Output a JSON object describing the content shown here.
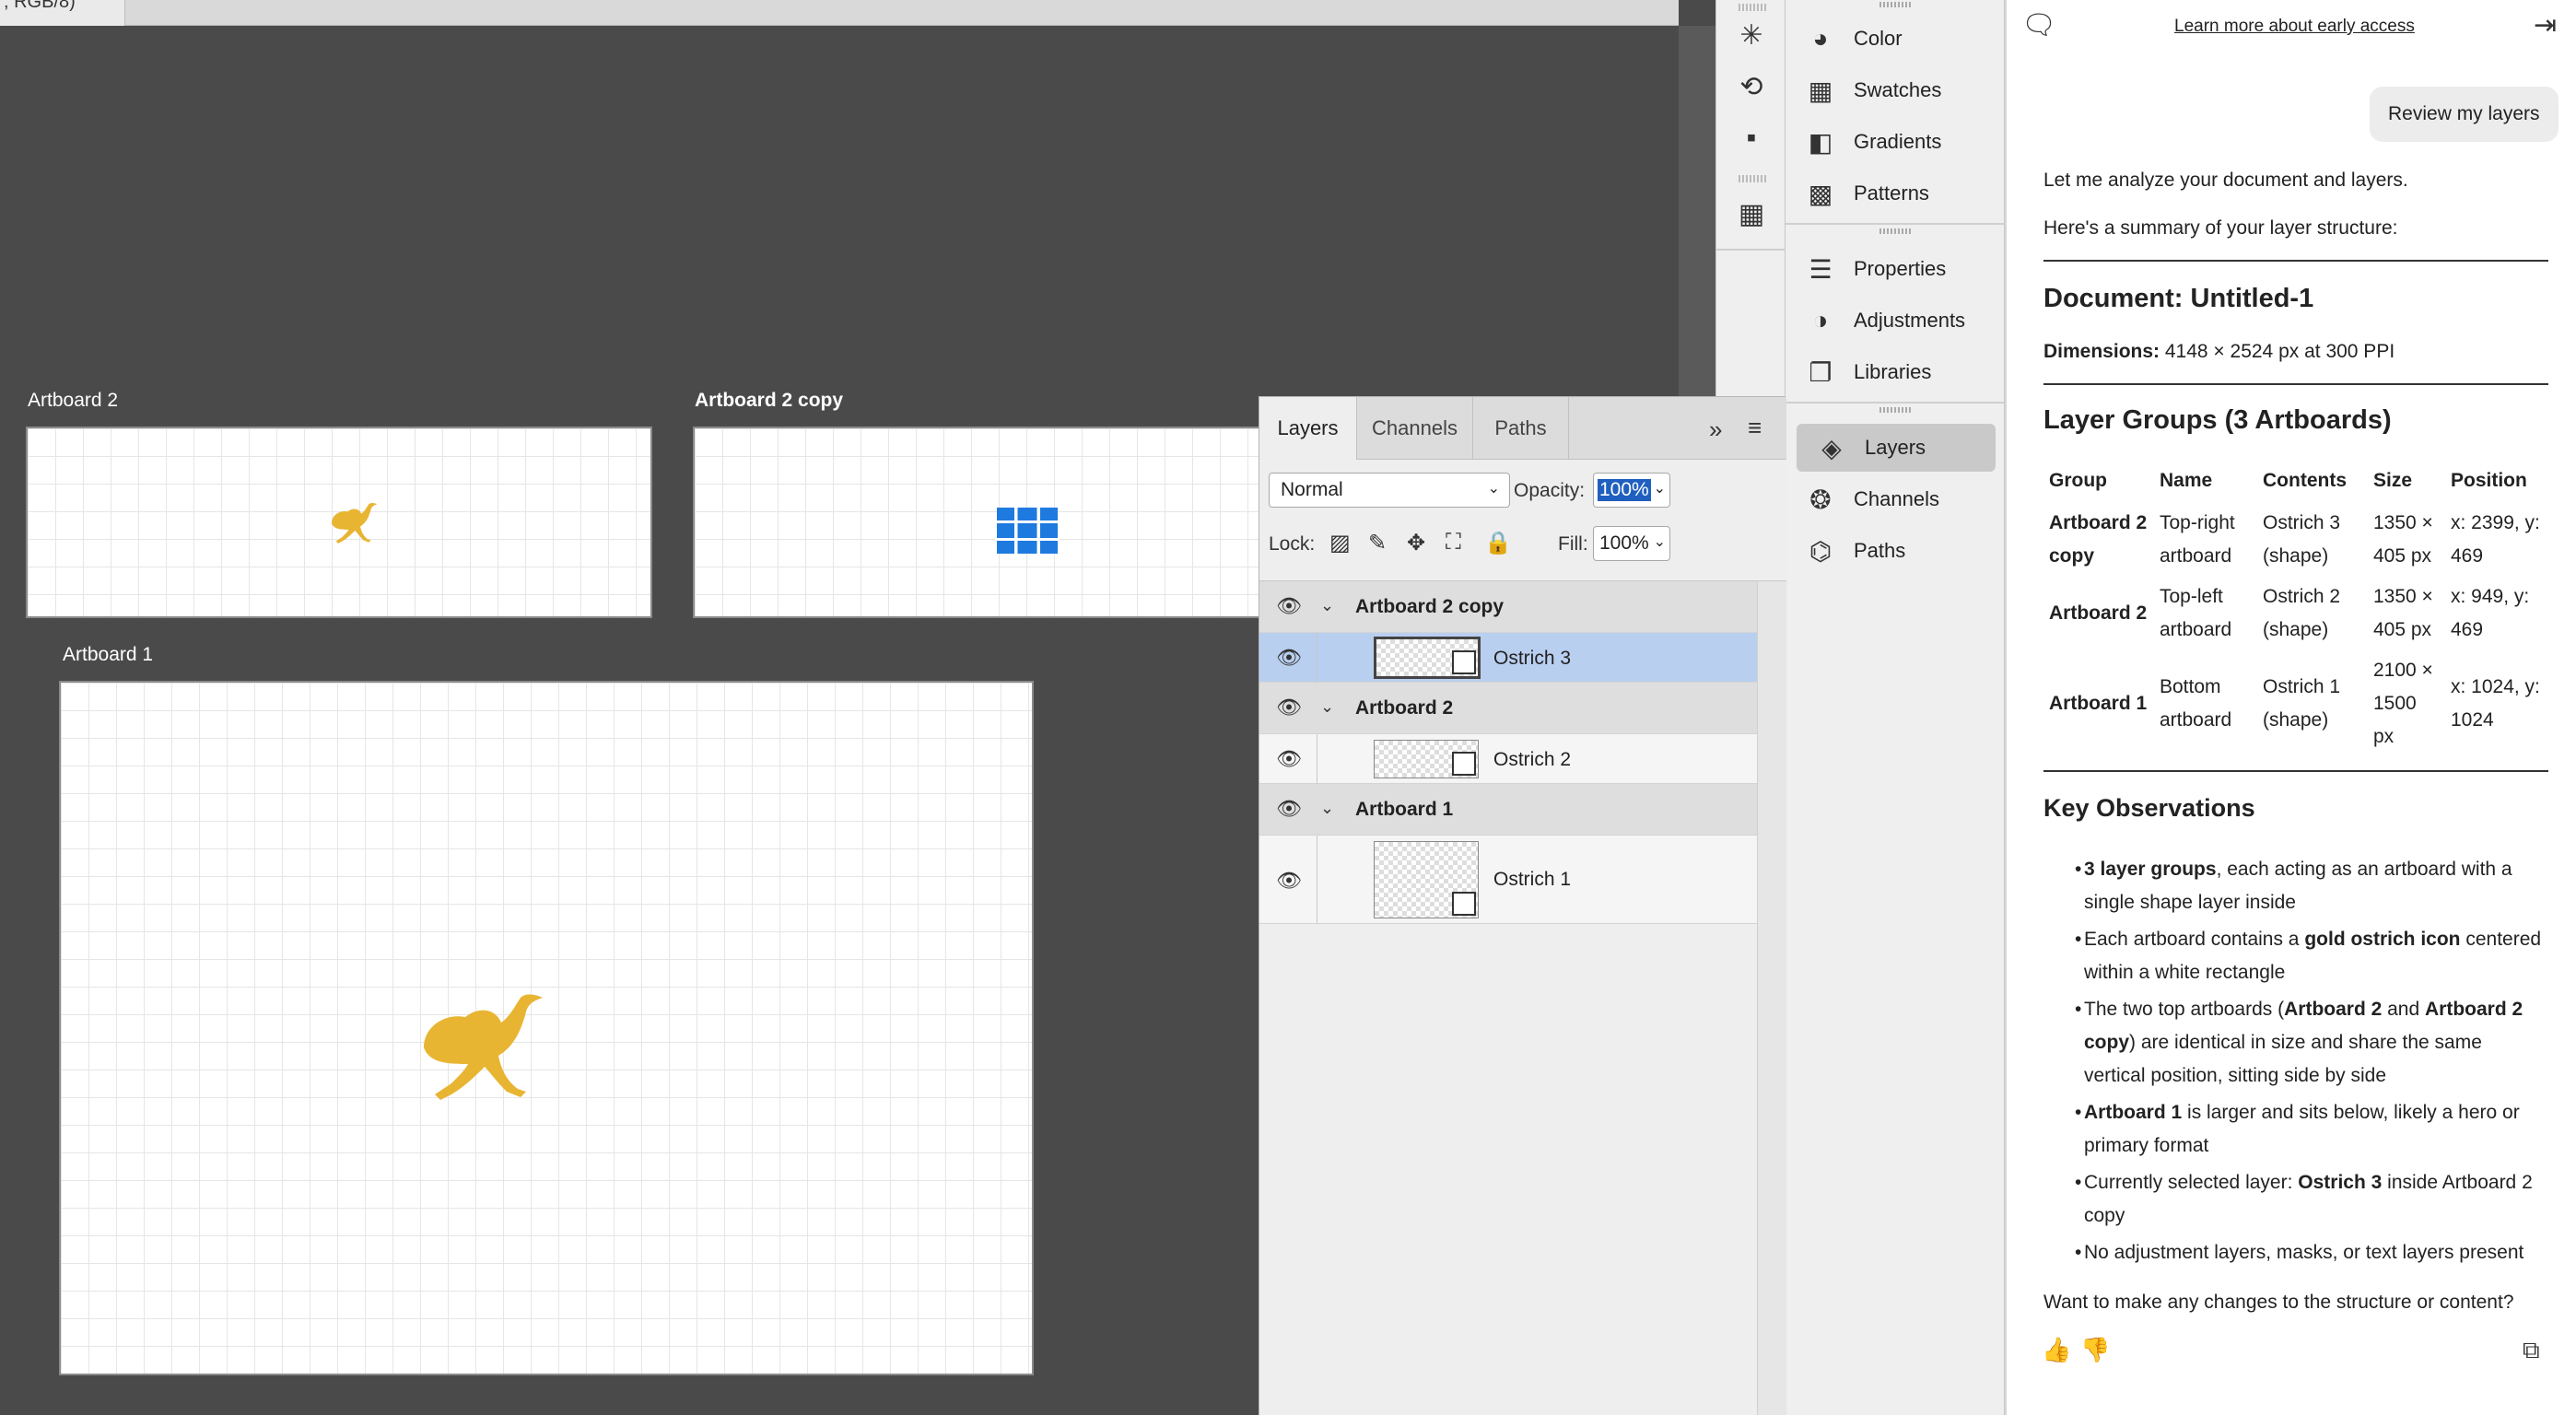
{
  "doc_tab": {
    "title": ", RGB/8)"
  },
  "canvas": {
    "artboards": [
      {
        "label": "Artboard 2"
      },
      {
        "label": "Artboard 2 copy"
      },
      {
        "label": "Artboard 1"
      }
    ]
  },
  "tools": [
    "magic-wand-icon",
    "history-brush-icon",
    "plugin-icon",
    "workspace-icon"
  ],
  "dock": {
    "items": [
      {
        "label": "Color",
        "icon": "palette-icon"
      },
      {
        "label": "Swatches",
        "icon": "swatches-icon"
      },
      {
        "label": "Gradients",
        "icon": "gradient-icon"
      },
      {
        "label": "Patterns",
        "icon": "patterns-icon"
      },
      {
        "label": "Properties",
        "icon": "properties-icon"
      },
      {
        "label": "Adjustments",
        "icon": "adjustments-icon"
      },
      {
        "label": "Libraries",
        "icon": "libraries-icon"
      },
      {
        "label": "Layers",
        "icon": "layers-icon"
      },
      {
        "label": "Channels",
        "icon": "channels-icon"
      },
      {
        "label": "Paths",
        "icon": "paths-icon"
      }
    ]
  },
  "layers_panel": {
    "tabs": [
      "Layers",
      "Channels",
      "Paths"
    ],
    "blend_mode": "Normal",
    "opacity_label": "Opacity:",
    "opacity_value": "100%",
    "lock_label": "Lock:",
    "fill_label": "Fill:",
    "fill_value": "100%",
    "groups": [
      {
        "name": "Artboard 2 copy",
        "layer": "Ostrich 3",
        "selected": true
      },
      {
        "name": "Artboard 2",
        "layer": "Ostrich 2",
        "selected": false
      },
      {
        "name": "Artboard 1",
        "layer": "Ostrich 1",
        "selected": false
      }
    ]
  },
  "assistant": {
    "early_access_link": "Learn more about early access",
    "user_message": "Review my layers",
    "intro": "Let me analyze your document and layers.",
    "summary_intro": "Here's a summary of your layer structure:",
    "doc_heading": "Document: Untitled-1",
    "dimensions_label": "Dimensions:",
    "dimensions_value": "4148 × 2524 px at 300 PPI",
    "groups_heading": "Layer Groups (3 Artboards)",
    "table": {
      "headers": [
        "Group",
        "Name",
        "Contents",
        "Size",
        "Position"
      ],
      "rows": [
        {
          "group": [
            "Artboard 2",
            "copy"
          ],
          "name": [
            "Top-right",
            "artboard"
          ],
          "contents": [
            "Ostrich 3",
            "(shape)"
          ],
          "size": [
            "1350 ×",
            "405 px"
          ],
          "position": [
            "x: 2399, y:",
            "469"
          ]
        },
        {
          "group": [
            "Artboard 2"
          ],
          "name": [
            "Top-left",
            "artboard"
          ],
          "contents": [
            "Ostrich 2",
            "(shape)"
          ],
          "size": [
            "1350 ×",
            "405 px"
          ],
          "position": [
            "x: 949, y:",
            "469"
          ]
        },
        {
          "group": [
            "Artboard 1"
          ],
          "name": [
            "Bottom",
            "artboard"
          ],
          "contents": [
            "Ostrich 1",
            "(shape)"
          ],
          "size": [
            "2100 ×",
            "1500",
            "px"
          ],
          "position": [
            "x: 1024, y:",
            "1024"
          ]
        }
      ]
    },
    "observations_heading": "Key Observations",
    "observations": [
      [
        "<b>3 layer groups</b>, each acting as an artboard with a",
        "single shape layer inside"
      ],
      [
        "Each artboard contains a <b>gold ostrich icon</b> centered",
        "within a white rectangle"
      ],
      [
        "The two top artboards (<b>Artboard 2</b> and <b>Artboard 2</b>",
        "<b>copy</b>) are identical in size and share the same",
        "vertical position, sitting side by side"
      ],
      [
        "<b>Artboard 1</b> is larger and sits below, likely a hero or",
        "primary format"
      ],
      [
        "Currently selected layer: <b>Ostrich 3</b> inside Artboard 2",
        "copy"
      ],
      [
        "No adjustment layers, masks, or text layers present"
      ]
    ],
    "closing": "Want to make any changes to the structure or content?"
  }
}
